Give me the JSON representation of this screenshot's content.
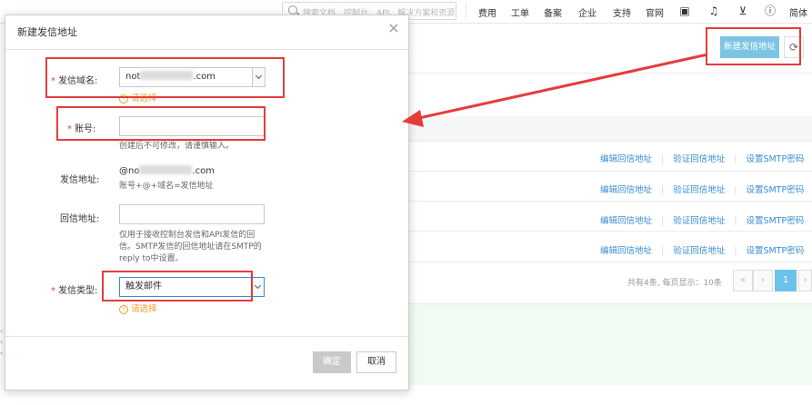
{
  "topbar": {
    "search_placeholder": "搜索文档、控制台、API、解决方案和资源",
    "nav": [
      "费用",
      "工单",
      "备案",
      "企业",
      "支持",
      "官网"
    ],
    "lang": "简体",
    "icons": [
      "terminal-icon",
      "bell-icon",
      "cart-icon",
      "help-icon"
    ]
  },
  "console": {
    "new_button": "新建发信地址",
    "row_ops": [
      "编辑回信地址",
      "验证回信地址",
      "设置SMTP密码"
    ],
    "pager_info": "共有4条, 每页显示：10条",
    "pager_first": "«",
    "pager_prev": "‹",
    "pager_page": "1",
    "pager_next": "›"
  },
  "modal": {
    "title": "新建发信地址",
    "close": "×",
    "domain_label": "发信域名:",
    "domain_value_prefix": "not",
    "domain_value_suffix": ".com",
    "domain_error": "请选择",
    "account_label": "账号:",
    "account_value": "",
    "account_hint": "创建后不可修改，请谨慎输入。",
    "address_label": "发信地址:",
    "address_value_prefix": "@no",
    "address_value_suffix": ".com",
    "address_hint": "账号+@+域名=发信地址",
    "reply_label": "回信地址:",
    "reply_value": "",
    "reply_hint_lines": [
      "仅用于接收控制台发信和API发信的回",
      "信。SMTP发信的回信地址请在SMTP的",
      "reply to中设置。"
    ],
    "type_label": "发信类型:",
    "type_value": "触发邮件",
    "type_error": "请选择",
    "ok_button": "确定",
    "cancel_button": "取消"
  },
  "colors": {
    "accent": "#7dc4e3",
    "link": "#3b8ed3",
    "error": "#f59b23",
    "required": "#e04040",
    "annotation": "#e63b3b"
  }
}
